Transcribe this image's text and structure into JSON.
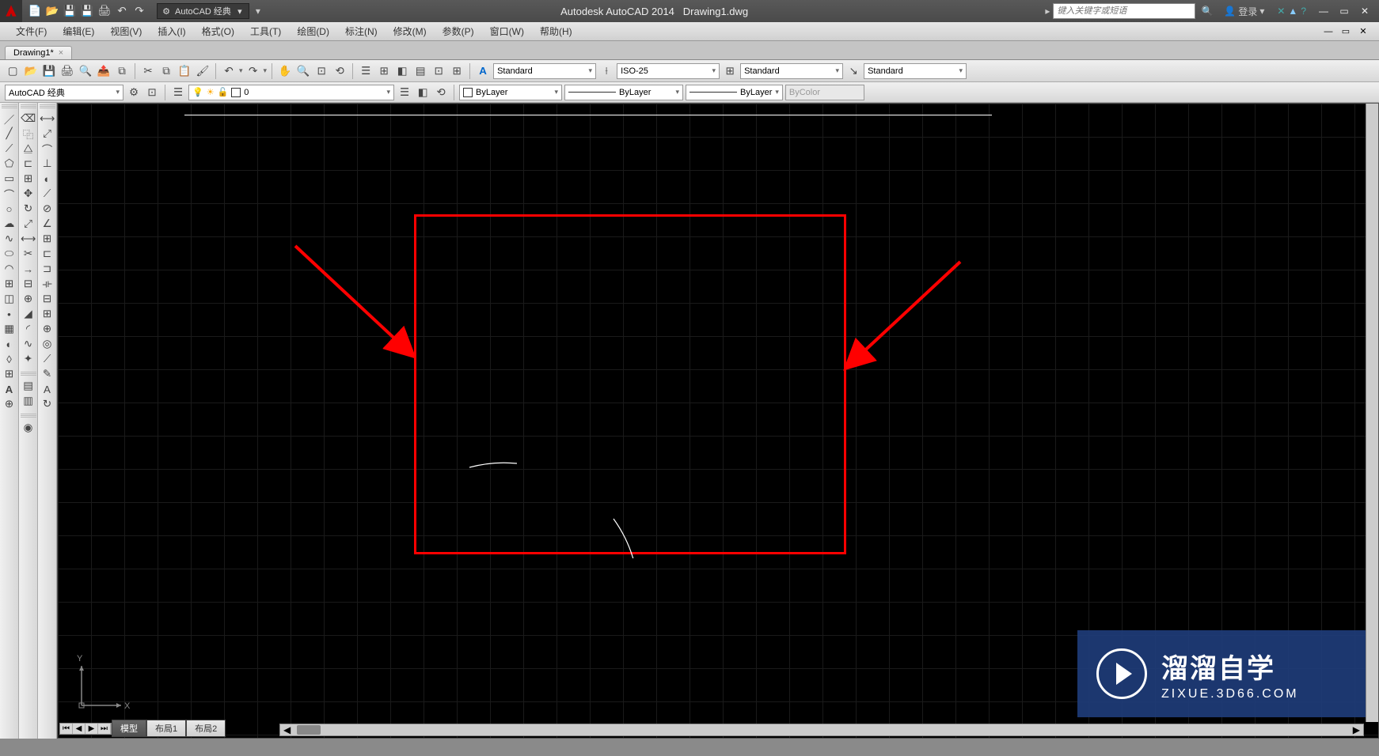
{
  "app": {
    "title": "Autodesk AutoCAD 2014",
    "document": "Drawing1.dwg",
    "workspace": "AutoCAD 经典",
    "search_placeholder": "键入关键字或短语",
    "signin": "登录"
  },
  "menus": [
    "文件(F)",
    "编辑(E)",
    "视图(V)",
    "插入(I)",
    "格式(O)",
    "工具(T)",
    "绘图(D)",
    "标注(N)",
    "修改(M)",
    "参数(P)",
    "窗口(W)",
    "帮助(H)"
  ],
  "doc_tab": {
    "label": "Drawing1*"
  },
  "styles": {
    "text_style": "Standard",
    "dim_style": "ISO-25",
    "table_style": "Standard",
    "mleader_style": "Standard"
  },
  "workspace_row": {
    "ws_dropdown": "AutoCAD 经典",
    "layer_current": "0"
  },
  "properties": {
    "color": "ByLayer",
    "linetype": "ByLayer",
    "lineweight": "ByLayer",
    "plotstyle": "ByColor"
  },
  "model_tabs": [
    "模型",
    "布局1",
    "布局2"
  ],
  "ucs": {
    "x": "X",
    "y": "Y"
  },
  "watermark": {
    "line1": "溜溜自学",
    "line2": "ZIXUE.3D66.COM"
  }
}
